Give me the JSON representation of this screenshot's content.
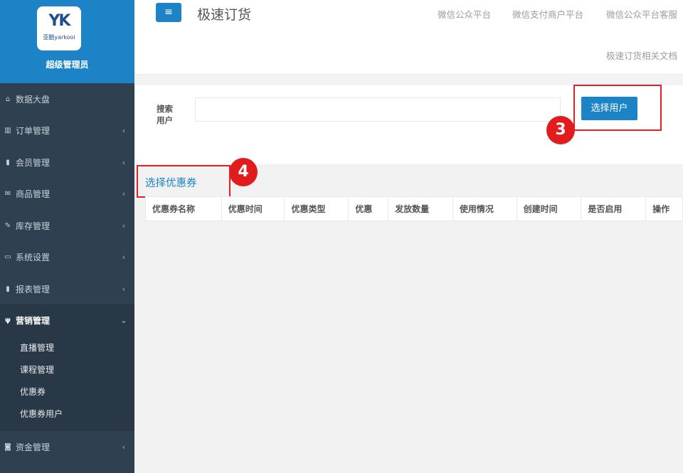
{
  "brand": {
    "logo_mark": "YK",
    "logo_text": "亚酷yarkooi",
    "role": "超级管理员"
  },
  "nav": {
    "items": [
      {
        "label": "数据大盘",
        "icon": "home-icon",
        "glyph": "⌂",
        "arrow": ""
      },
      {
        "label": "订单管理",
        "icon": "columns-icon",
        "glyph": "▥",
        "arrow": "‹"
      },
      {
        "label": "会员管理",
        "icon": "bar-chart-icon",
        "glyph": "▮",
        "arrow": "‹"
      },
      {
        "label": "商品管理",
        "icon": "envelope-icon",
        "glyph": "✉",
        "arrow": "‹"
      },
      {
        "label": "库存管理",
        "icon": "edit-icon",
        "glyph": "✎",
        "arrow": "‹"
      },
      {
        "label": "系统设置",
        "icon": "desktop-icon",
        "glyph": "▭",
        "arrow": "‹"
      },
      {
        "label": "报表管理",
        "icon": "bar-chart-icon",
        "glyph": "▮",
        "arrow": "‹"
      },
      {
        "label": "营销管理",
        "icon": "cutlery-icon",
        "glyph": "ψ",
        "arrow": "⌄"
      },
      {
        "label": "资金管理",
        "icon": "money-icon",
        "glyph": "◙",
        "arrow": "‹"
      }
    ],
    "submenu": [
      "直播管理",
      "课程管理",
      "优惠券",
      "优惠券用户"
    ]
  },
  "header": {
    "menu_glyph": "≡",
    "title": "极速订货",
    "links": [
      "微信公众平台",
      "微信支付商户平台",
      "微信公众平台客服",
      "极速订货相关文档"
    ]
  },
  "search": {
    "label": "搜索用户",
    "input_value": "",
    "button": "选择用户"
  },
  "annotations": {
    "badge3": "3",
    "badge4": "4"
  },
  "coupon": {
    "link": "选择优惠券",
    "columns": [
      "优惠券名称",
      "优惠时间",
      "优惠类型",
      "优惠",
      "发放数量",
      "使用情况",
      "创建时间",
      "是否启用",
      "操作"
    ]
  },
  "colors": {
    "sidebar_bg": "#2f4050",
    "brand_blue": "#1c84c6",
    "annotation_red": "#e3202a"
  }
}
